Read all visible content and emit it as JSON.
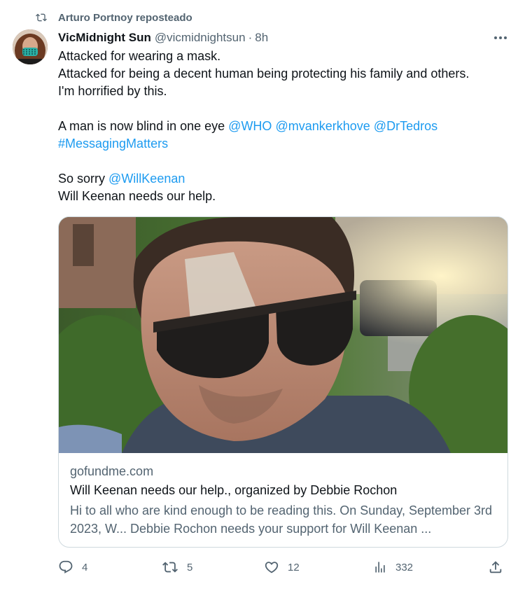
{
  "repost": {
    "icon": "repost-icon",
    "text": "Arturo Portnoy reposteado"
  },
  "tweet": {
    "author": {
      "name": "VicMidnight Sun",
      "handle": "@vicmidnightsun",
      "separator": "·",
      "time": "8h",
      "avatar_icon": "avatar"
    },
    "more_icon": "more-icon",
    "text": {
      "line1": "Attacked for wearing a mask.",
      "line2": "Attacked for being a decent human being protecting his family and others.",
      "line3": "I'm horrified by this.",
      "line4_text": "A man is now blind in one eye",
      "mention_who": "@WHO",
      "mention_mvk": "@mvankerkhove",
      "mention_tedros": "@DrTedros",
      "hashtag": "#MessagingMatters",
      "line6_text": "So sorry",
      "mention_will": "@WillKeenan",
      "line7": "Will Keenan needs our help."
    },
    "card": {
      "domain": "gofundme.com",
      "title": "Will Keenan needs our help., organized by Debbie Rochon",
      "description": "Hi to all who are kind enough to be reading this. On Sunday, September 3rd 2023, W... Debbie Rochon needs your support for Will Keenan ..."
    },
    "actions": {
      "reply": {
        "icon": "reply-icon",
        "count": "4"
      },
      "repost": {
        "icon": "repost-icon",
        "count": "5"
      },
      "like": {
        "icon": "heart-icon",
        "count": "12"
      },
      "views": {
        "icon": "views-icon",
        "count": "332"
      },
      "share": {
        "icon": "share-icon"
      }
    }
  },
  "colors": {
    "link": "#1d9bf0",
    "secondary": "#536471",
    "text": "#0f1419",
    "border": "#cfd9de"
  }
}
